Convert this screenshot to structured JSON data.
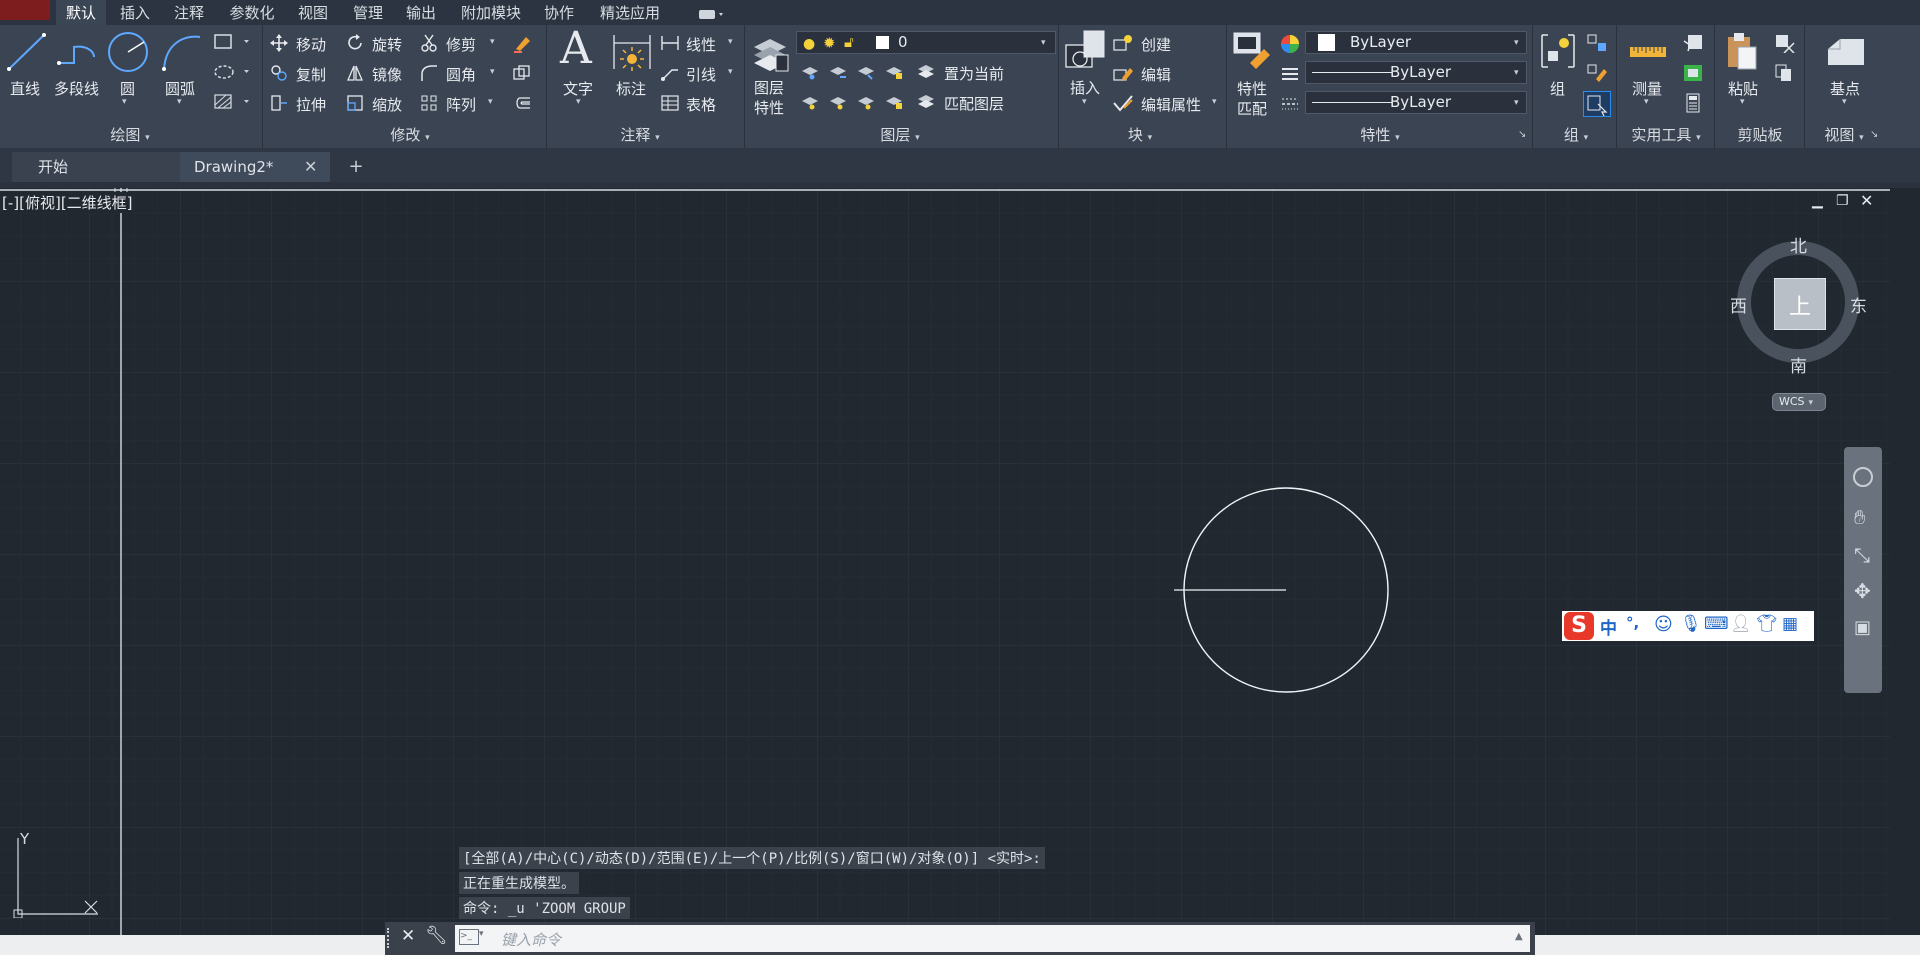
{
  "ribbon": {
    "tabs": [
      "默认",
      "插入",
      "注释",
      "参数化",
      "视图",
      "管理",
      "输出",
      "附加模块",
      "协作",
      "精选应用"
    ],
    "active_tab": "默认",
    "draw": {
      "line": "直线",
      "polyline": "多段线",
      "circle": "圆",
      "arc": "圆弧",
      "title": "绘图"
    },
    "modify": {
      "move": "移动",
      "rotate": "旋转",
      "trim": "修剪",
      "copy": "复制",
      "mirror": "镜像",
      "fillet": "圆角",
      "stretch": "拉伸",
      "scale": "缩放",
      "array": "阵列",
      "title": "修改"
    },
    "annotation": {
      "text": "文字",
      "dimension": "标注",
      "linear": "线性",
      "leader": "引线",
      "table": "表格",
      "title": "注释"
    },
    "layers": {
      "layer_props_1": "图层",
      "layer_props_2": "特性",
      "current_layer": "0",
      "set_current": "置为当前",
      "match_layer": "匹配图层",
      "title": "图层"
    },
    "block": {
      "insert": "插入",
      "create": "创建",
      "edit": "编辑",
      "edit_attr": "编辑属性",
      "title": "块"
    },
    "properties": {
      "match_1": "特性",
      "match_2": "匹配",
      "color": "ByLayer",
      "linetype": "ByLayer",
      "lineweight": "ByLayer",
      "title": "特性"
    },
    "groups": {
      "group": "组",
      "title": "组"
    },
    "utilities": {
      "measure": "测量",
      "title": "实用工具"
    },
    "clipboard": {
      "paste": "粘贴",
      "title": "剪贴板"
    },
    "view": {
      "base": "基点",
      "title": "视图"
    }
  },
  "doc_tabs": {
    "start": "开始",
    "drawing": "Drawing2*"
  },
  "viewport": {
    "label": "[-][俯视][二维线框]",
    "compass": {
      "north": "北",
      "south": "南",
      "east": "东",
      "west": "西",
      "top": "上"
    },
    "wcs": "WCS",
    "ucs_y": "Y"
  },
  "ime": {
    "lang": "中",
    "punct": "°,"
  },
  "command": {
    "history": [
      "[全部(A)/中心(C)/动态(D)/范围(E)/上一个(P)/比例(S)/窗口(W)/对象(O)] <实时>:",
      "正在重生成模型。",
      "命令: _u 'ZOOM GROUP"
    ],
    "placeholder": "键入命令"
  },
  "colors": {
    "accent": "#2c8cf0",
    "background": "#212830",
    "ribbon": "#3b4453"
  }
}
